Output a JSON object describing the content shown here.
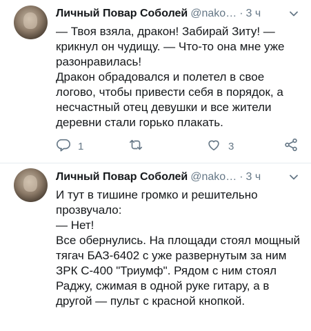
{
  "tweets": [
    {
      "author_name": "Личный Повар Соболей",
      "handle": "@nako…",
      "separator": "·",
      "time": "3 ч",
      "paragraphs": [
        "— Твоя взяла, дракон! Забирай Зиту! — крикнул он чудищу. — Что-то она мне уже разонравилась!",
        "Дракон обрадовался и полетел в свое логово, чтобы привести себя в порядок, а несчастный отец девушки и все жители деревни стали горько плакать."
      ],
      "reply_count": "1",
      "retweet_count": "",
      "like_count": "3"
    },
    {
      "author_name": "Личный Повар Соболей",
      "handle": "@nako…",
      "separator": "·",
      "time": "3 ч",
      "paragraphs": [
        "И тут в тишине громко и решительно прозвучало:",
        "— Нет!",
        "Все обернулись. На площади стоял мощный тягач БАЗ-6402 с уже развернутым за ним ЗРК С-400 \"Триумф\". Рядом с ним стоял Раджу, сжимая в одной руке гитару, а в другой — пульт с красной кнопкой."
      ]
    }
  ],
  "icons": {
    "menu": "chevron-down-icon",
    "reply": "reply-icon",
    "retweet": "retweet-icon",
    "like": "heart-icon",
    "share": "share-icon"
  },
  "colors": {
    "text": "#14171a",
    "secondary": "#657786",
    "divider": "#e6ecf0"
  }
}
